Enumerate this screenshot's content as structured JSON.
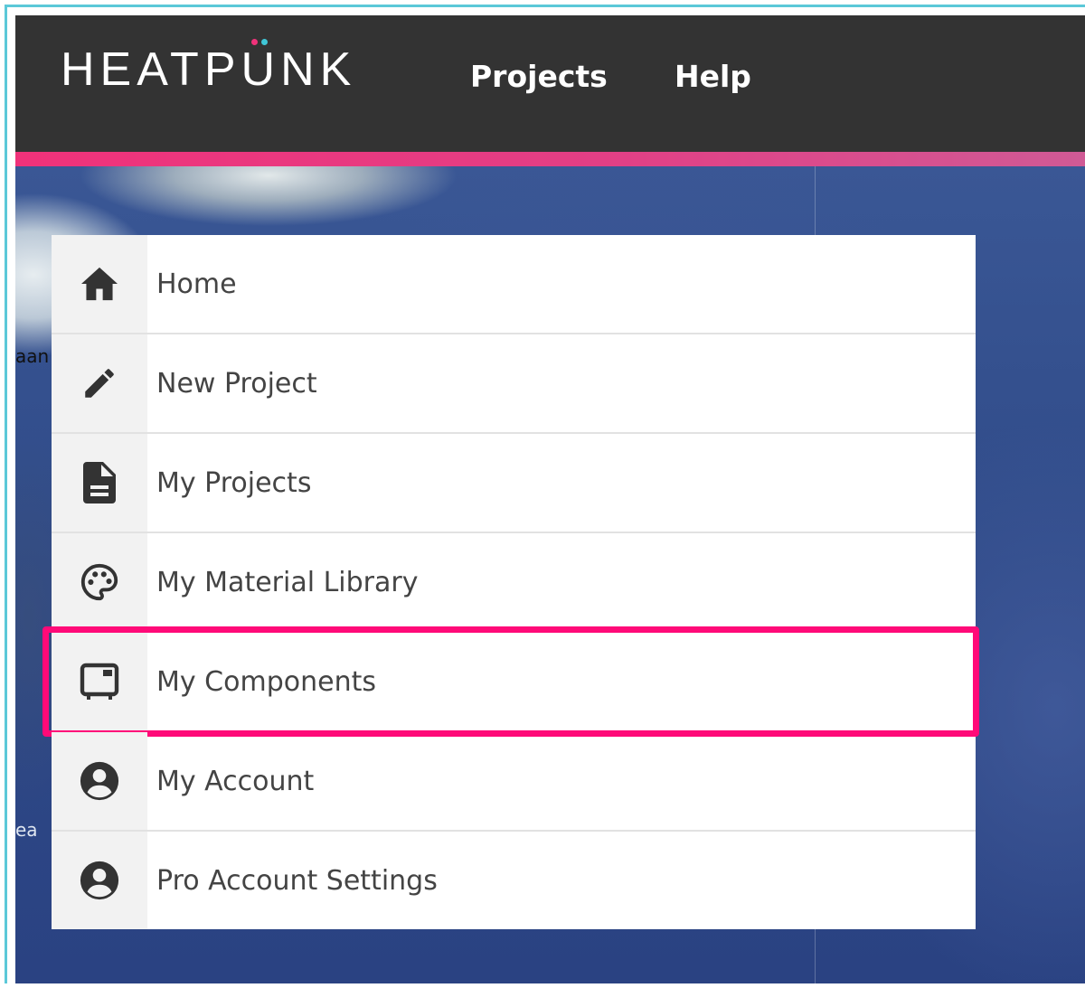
{
  "header": {
    "logo": "HEATPUNK",
    "nav": [
      "Projects",
      "Help"
    ]
  },
  "map": {
    "labels": [
      "aan",
      "ea"
    ]
  },
  "menu": {
    "items": [
      {
        "label": "Home",
        "icon": "home-icon"
      },
      {
        "label": "New Project",
        "icon": "pencil-icon"
      },
      {
        "label": "My Projects",
        "icon": "document-icon"
      },
      {
        "label": "My Material Library",
        "icon": "palette-icon"
      },
      {
        "label": "My Components",
        "icon": "component-icon",
        "highlighted": true
      },
      {
        "label": "My Account",
        "icon": "account-icon"
      },
      {
        "label": "Pro Account Settings",
        "icon": "account-icon"
      }
    ]
  },
  "colors": {
    "header_bg": "#333333",
    "accent_pink": "#f0327a",
    "highlight": "#ff0a78",
    "frame": "#5bc8d8"
  }
}
